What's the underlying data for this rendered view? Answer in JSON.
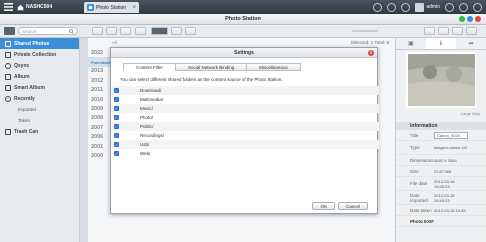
{
  "topbar": {
    "home_label": "NASHC504",
    "app_tab_label": "Photo Station",
    "user_label": "admin"
  },
  "window": {
    "title": "Photo Station"
  },
  "toolbar": {
    "search_placeholder": "Search"
  },
  "sidebar": {
    "items": [
      {
        "label": "Shared Photos",
        "icon": "image-icon"
      },
      {
        "label": "Private Collection",
        "icon": "lock-icon"
      },
      {
        "label": "Qsync",
        "icon": "sync-icon"
      },
      {
        "label": "Album",
        "icon": "album-icon"
      },
      {
        "label": "Smart Album",
        "icon": "smart-album-icon"
      },
      {
        "label": "Recently",
        "icon": "clock-icon"
      }
    ],
    "subitems": [
      "Imported",
      "Taken"
    ],
    "trash_label": "Trash Can"
  },
  "timeline": {
    "all_label": "All",
    "years": [
      "2022",
      "Patchdate",
      "2013",
      "2012",
      "2011",
      "2010",
      "2009",
      "2008",
      "2007",
      "2006",
      "2001",
      "2000"
    ]
  },
  "main": {
    "selected_label": "Selected: 1  Total: 6"
  },
  "modal": {
    "title": "Settings",
    "close_label": "x",
    "tabs": [
      "Content Filter",
      "Social Network Binding",
      "Miscellaneous"
    ],
    "description": "You can select different shared folders as the content source of the Photo Station.",
    "folders": [
      "Download/",
      "Multimedia/",
      "Music/",
      "Photo/",
      "Public/",
      "Recordings/",
      "Usb/",
      "Web/"
    ],
    "ok_label": "OK",
    "cancel_label": "Cancel"
  },
  "info_panel": {
    "large_map_label": "Large Map",
    "heading": "Information",
    "rows": [
      {
        "key": "Title",
        "value": "Canon_0024"
      },
      {
        "key": "Type",
        "value": "image/x-canon-cr2"
      },
      {
        "key": "Dimensions",
        "value": "4592 X 3064"
      },
      {
        "key": "Size",
        "value": "22.67 MB"
      },
      {
        "key": "File date",
        "value": "2013-03-18 19:45:23"
      },
      {
        "key": "Date Imported",
        "value": "2013-03-18 19:45:23"
      },
      {
        "key": "Date taken",
        "value": "2013-03-18 19:45"
      }
    ],
    "photo_exif_label": "Photo EXIF"
  },
  "colors": {
    "accent": "#3c8fd6",
    "topbar": "#323a44",
    "close": "#e2463c"
  }
}
